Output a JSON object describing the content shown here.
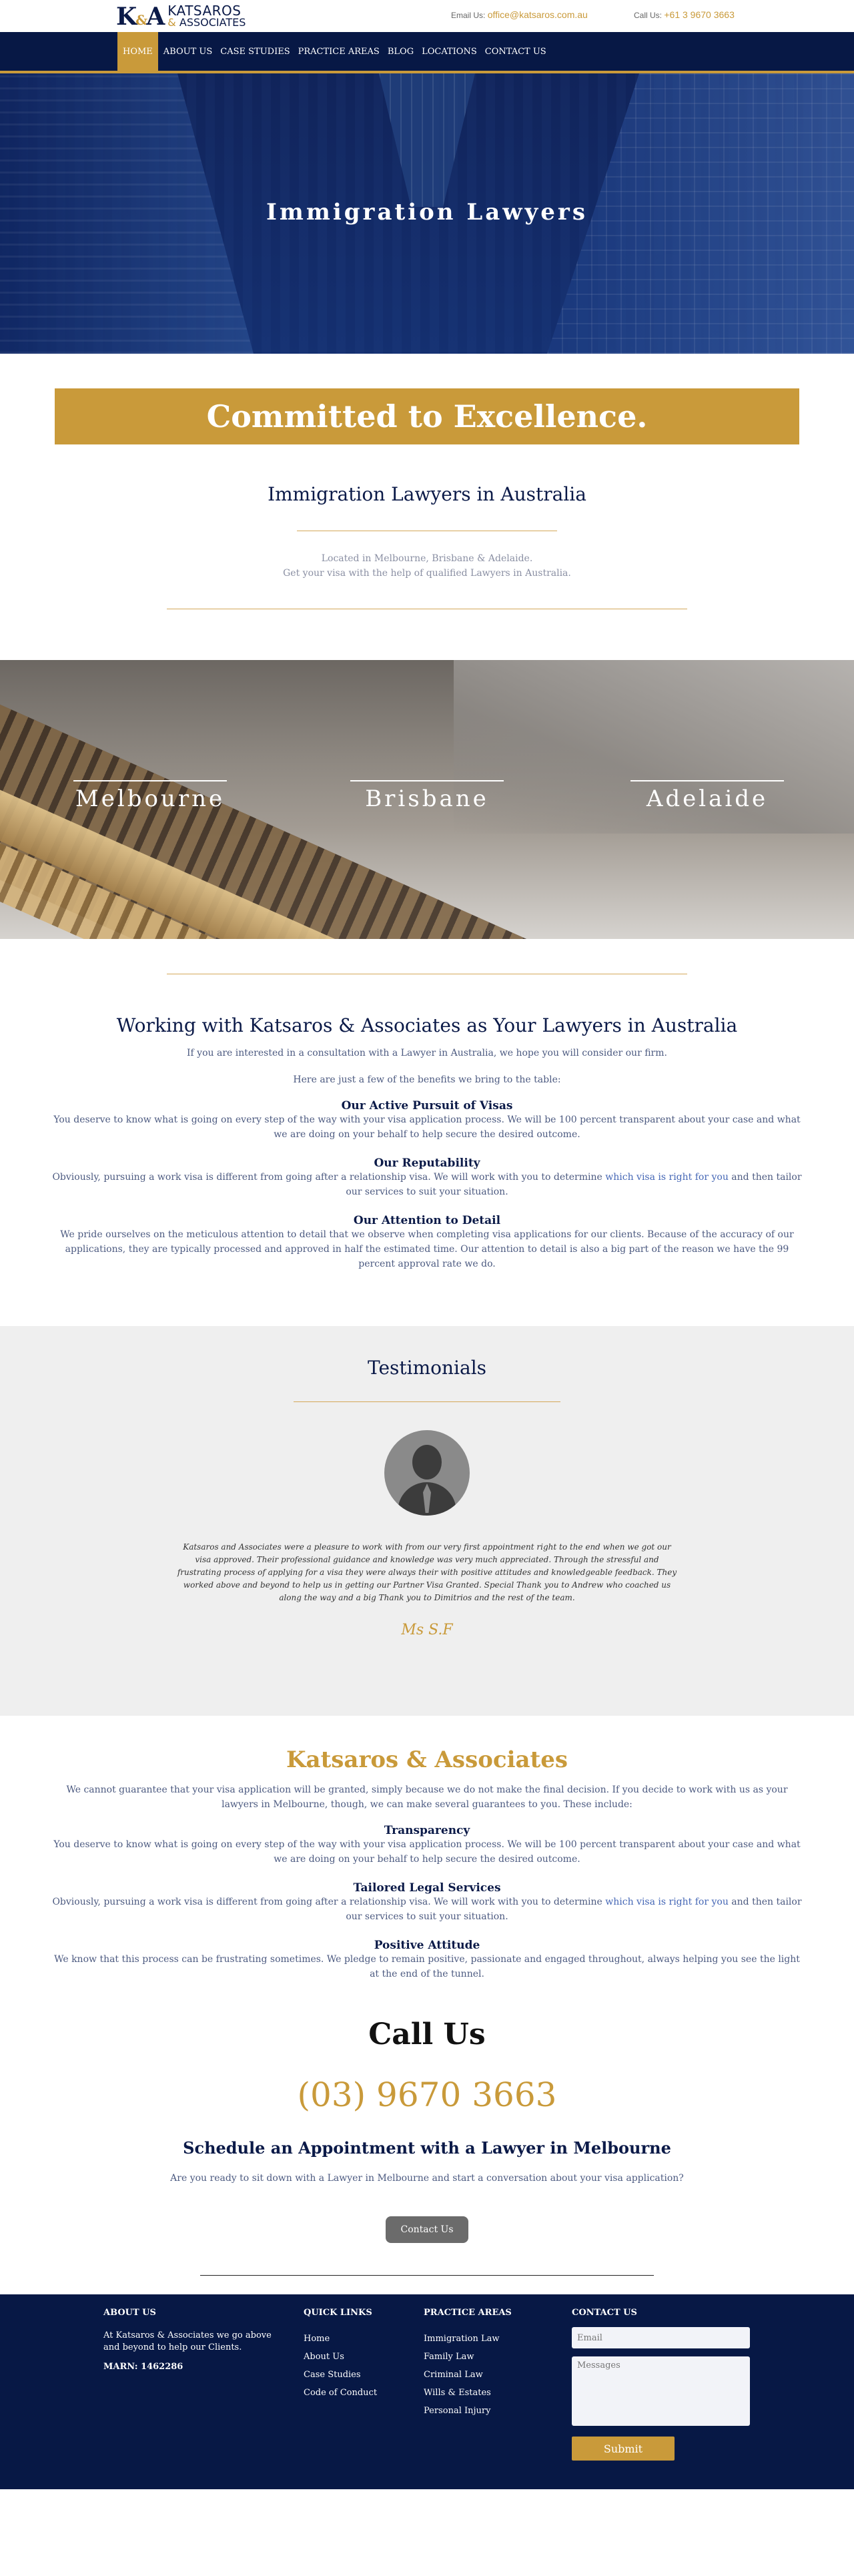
{
  "header": {
    "logo_mark": "K",
    "logo_amp": "&",
    "logo_mark2": "A",
    "logo_line1": "KATSAROS",
    "logo_amp2": "&",
    "logo_line2": "ASSOCIATES",
    "email_label": "Email Us:",
    "email_value": "office@katsaros.com.au",
    "phone_label": "Call Us:",
    "phone_value": "+61 3 9670 3663"
  },
  "nav": {
    "items": [
      "HOME",
      "ABOUT US",
      "CASE STUDIES",
      "PRACTICE AREAS",
      "BLOG",
      "LOCATIONS",
      "CONTACT US"
    ],
    "active": "HOME"
  },
  "hero": {
    "title": "Immigration Lawyers"
  },
  "committed": {
    "title": "Committed to Excellence."
  },
  "intro": {
    "title": "Immigration Lawyers in Australia",
    "line1": "Located in Melbourne, Brisbane & Adelaide.",
    "line2": "Get your visa with the help of qualified Lawyers in Australia."
  },
  "cities": [
    "Melbourne",
    "Brisbane",
    "Adelaide"
  ],
  "working": {
    "title": "Working with Katsaros & Associates as Your Lawyers in Australia",
    "p1": "If you are interested in a consultation with a Lawyer in Australia, we hope you will consider our firm.",
    "p2": "Here are just a few of the benefits we bring to the table:",
    "b1_title": "Our Active Pursuit of Visas",
    "b1_text": "You deserve to know what is going on every step of the way with your visa application process. We will be 100 percent transparent about your case and what we are doing on your behalf to help secure the desired outcome.",
    "b2_title": "Our Reputability",
    "b2_text_a": "Obviously, pursuing a work visa is different from going after a relationship visa. We will work with you to determine ",
    "b2_link": "which visa is right for you",
    "b2_text_b": " and then tailor our services to suit your situation.",
    "b3_title": "Our Attention to Detail",
    "b3_text": "We pride ourselves on the meticulous attention to detail that we observe when completing visa applications for our clients. Because of the accuracy of our applications, they are typically processed and approved in half the estimated time. Our attention to detail is also a big part of the reason we have the 99 percent approval rate we do."
  },
  "testimonials": {
    "title": "Testimonials",
    "quote": "Katsaros and Associates were a pleasure to work with from our very first appointment right to the end when we got our visa approved. Their professional guidance and knowledge was very much appreciated. Through the stressful and frustrating process of applying for a visa they were always their with positive attitudes and knowledgeable feedback. They worked above and beyond to help us in getting our Partner Visa Granted. Special Thank you to Andrew who coached us along the way and a big Thank you to Dimitrios and the rest of the team.",
    "author": "Ms S.F"
  },
  "katsaros": {
    "title": "Katsaros & Associates",
    "intro": "We cannot guarantee that your visa application will be granted, simply because we do not make the final decision. If you decide to work with us as your lawyers in Melbourne, though, we can make several guarantees to you. These include:",
    "g1_title": "Transparency",
    "g1_text": "You deserve to know what is going on every step of the way with your visa application process. We will be 100 percent transparent about your case and what we are doing on your behalf to help secure the desired outcome.",
    "g2_title": "Tailored Legal Services",
    "g2_text_a": "Obviously, pursuing a work visa is different from going after a relationship visa. We will work with you to determine ",
    "g2_link": "which visa is right for you",
    "g2_text_b": " and then tailor our services to suit your situation.",
    "g3_title": "Positive Attitude",
    "g3_text": "We know that this process can be frustrating sometimes. We pledge to remain positive, passionate and engaged throughout, always helping you see the light at the end of the tunnel."
  },
  "call": {
    "title": "Call Us",
    "number": "(03) 9670 3663",
    "schedule_title": "Schedule an Appointment with a Lawyer in Melbourne",
    "schedule_desc": "Are you ready to sit down with a Lawyer in Melbourne and start a conversation about your visa application?",
    "button": "Contact Us"
  },
  "footer": {
    "about_title": "ABOUT US",
    "about_text": "At Katsaros & Associates we go above and beyond to help our Clients.",
    "marn": "MARN: 1462286",
    "quick_title": "QUICK LINKS",
    "quick_links": [
      "Home",
      "About Us",
      "Case Studies",
      "Code of Conduct"
    ],
    "practice_title": "PRACTICE AREAS",
    "practice_links": [
      "Immigration Law",
      "Family Law",
      "Criminal Law",
      "Wills & Estates",
      "Personal Injury"
    ],
    "contact_title": "CONTACT US",
    "email_placeholder": "Email",
    "messages_placeholder": "Messages",
    "submit": "Submit"
  },
  "colors": {
    "navy": "#071845",
    "gold": "#c99a3a",
    "link": "#4466b5"
  }
}
